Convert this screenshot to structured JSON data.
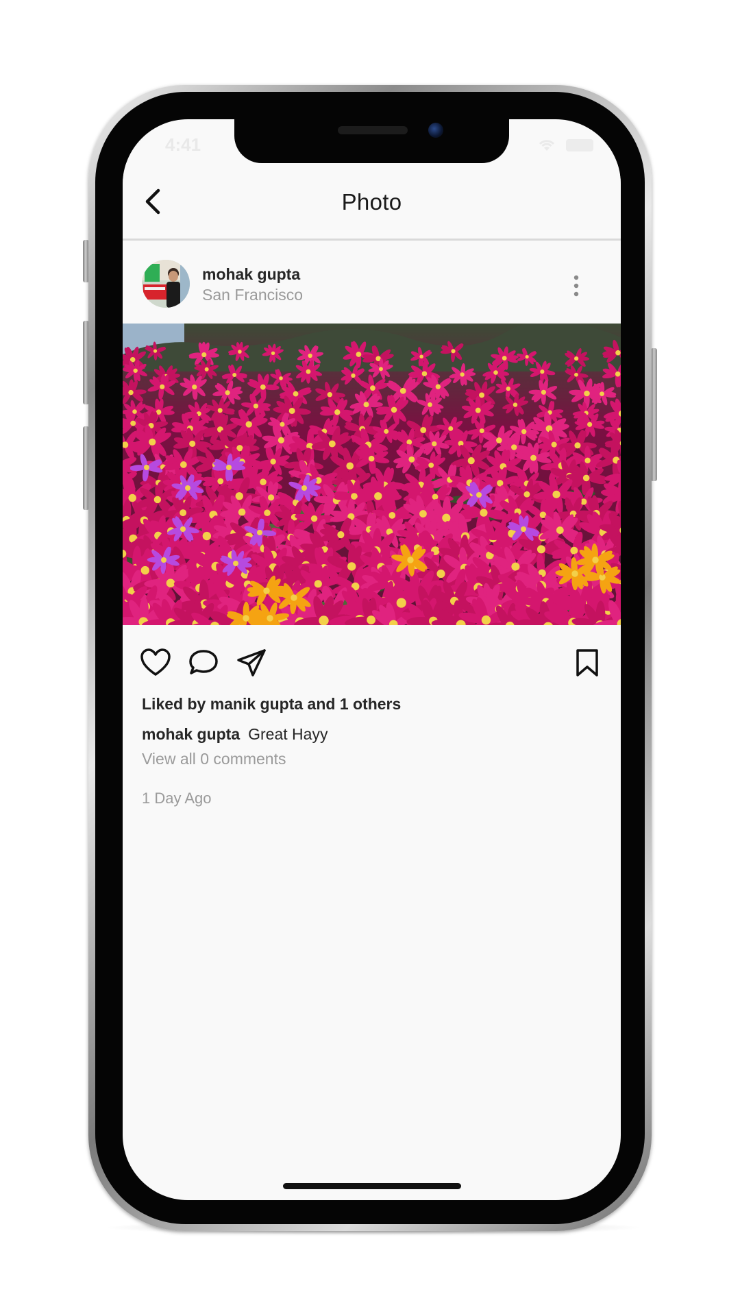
{
  "status_bar": {
    "time": "4:41"
  },
  "nav": {
    "title": "Photo"
  },
  "post": {
    "username": "mohak gupta",
    "location": "San Francisco",
    "likes_text": "Liked by manik gupta and 1 others",
    "caption_user": "mohak gupta",
    "caption_text": "Great Hayy",
    "view_comments": "View all 0 comments",
    "timestamp": "1 Day Ago"
  },
  "icons": {
    "back": "chevron-left-icon",
    "more": "more-vertical-icon",
    "like": "heart-icon",
    "comment": "comment-bubble-icon",
    "share": "paper-plane-icon",
    "save": "bookmark-icon"
  },
  "colors": {
    "background": "#f9f9f9",
    "text_primary": "#262626",
    "text_secondary": "#9a9a9a",
    "flower_magenta": "#d4166e",
    "flower_purple": "#b64ae0",
    "flower_orange": "#f5a312"
  }
}
